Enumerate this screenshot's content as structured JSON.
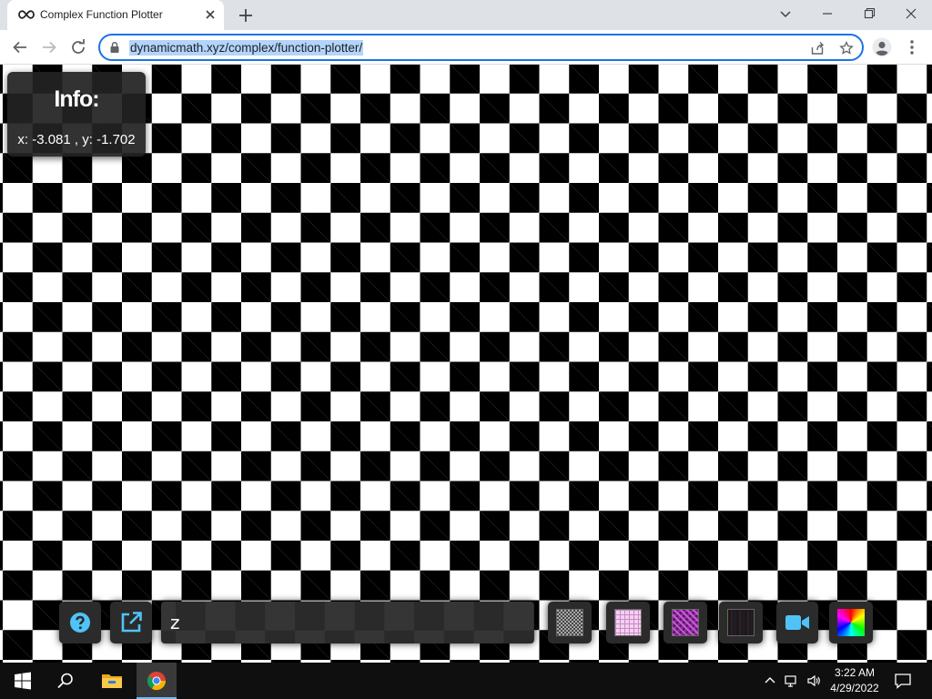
{
  "browser": {
    "tab_title": "Complex Function Plotter",
    "url": "dynamicmath.xyz/complex/function-plotter/"
  },
  "info": {
    "title": "Info:",
    "coords": "x: -3.081 , y: -1.702"
  },
  "controls": {
    "function_label": "z",
    "function_value": "",
    "buttons": [
      {
        "name": "help-button",
        "icon": "question-circle-icon"
      },
      {
        "name": "open-external-button",
        "icon": "external-link-icon"
      },
      {
        "name": "texture-checker-button",
        "icon": "checkerboard-swatch"
      },
      {
        "name": "texture-pink-grid-button",
        "icon": "pink-grid-swatch"
      },
      {
        "name": "texture-purple-button",
        "icon": "purple-pattern-swatch"
      },
      {
        "name": "texture-dark-stripes-button",
        "icon": "dark-stripes-swatch"
      },
      {
        "name": "record-video-button",
        "icon": "video-camera-icon"
      },
      {
        "name": "color-wheel-button",
        "icon": "color-wheel-swatch"
      }
    ]
  },
  "taskbar": {
    "time": "3:22 AM",
    "date": "4/29/2022"
  },
  "colors": {
    "accent": "#1a73e8",
    "panel_bg": "#222222",
    "icon_blue": "#4fc3f7"
  }
}
